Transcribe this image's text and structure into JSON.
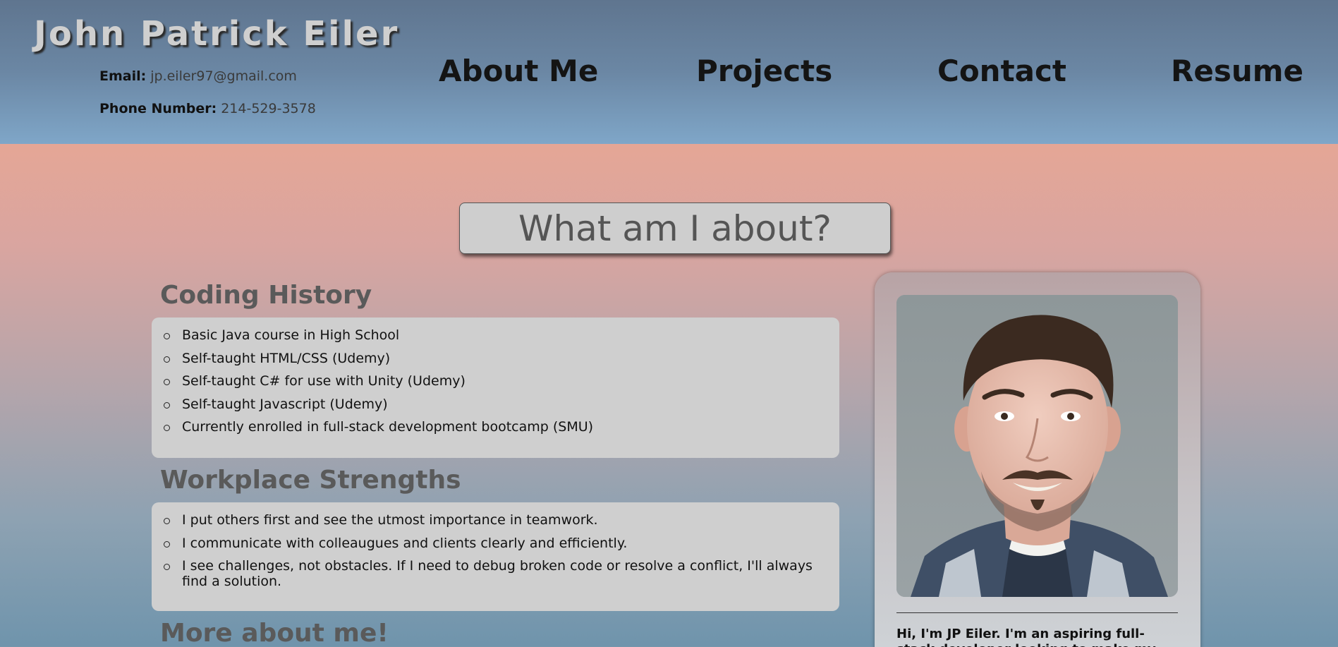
{
  "header": {
    "name": "John Patrick Eiler",
    "email_label": "Email:",
    "email_value": "jp.eiler97@gmail.com",
    "phone_label": "Phone Number:",
    "phone_value": "214-529-3578"
  },
  "nav": {
    "items": [
      {
        "label": "About Me"
      },
      {
        "label": "Projects"
      },
      {
        "label": "Contact"
      },
      {
        "label": "Resume"
      }
    ]
  },
  "main": {
    "heading": "What am I about?",
    "sections": [
      {
        "title": "Coding History",
        "items": [
          "Basic Java course in High School",
          "Self-taught HTML/CSS (Udemy)",
          "Self-taught C# for use with Unity (Udemy)",
          "Self-taught Javascript (Udemy)",
          "Currently enrolled in full-stack development bootcamp (SMU)"
        ]
      },
      {
        "title": "Workplace Strengths",
        "items": [
          "I put others first and see the utmost importance in teamwork.",
          "I communicate with colleaugues and clients clearly and efficiently.",
          "I see challenges, not obstacles. If I need to debug broken code or resolve a conflict, I'll always find a solution."
        ]
      },
      {
        "title": "More about me!"
      }
    ]
  },
  "profile": {
    "intro": "Hi, I'm JP Eiler. I'm an aspiring full-stack developer looking to make my way. You"
  }
}
